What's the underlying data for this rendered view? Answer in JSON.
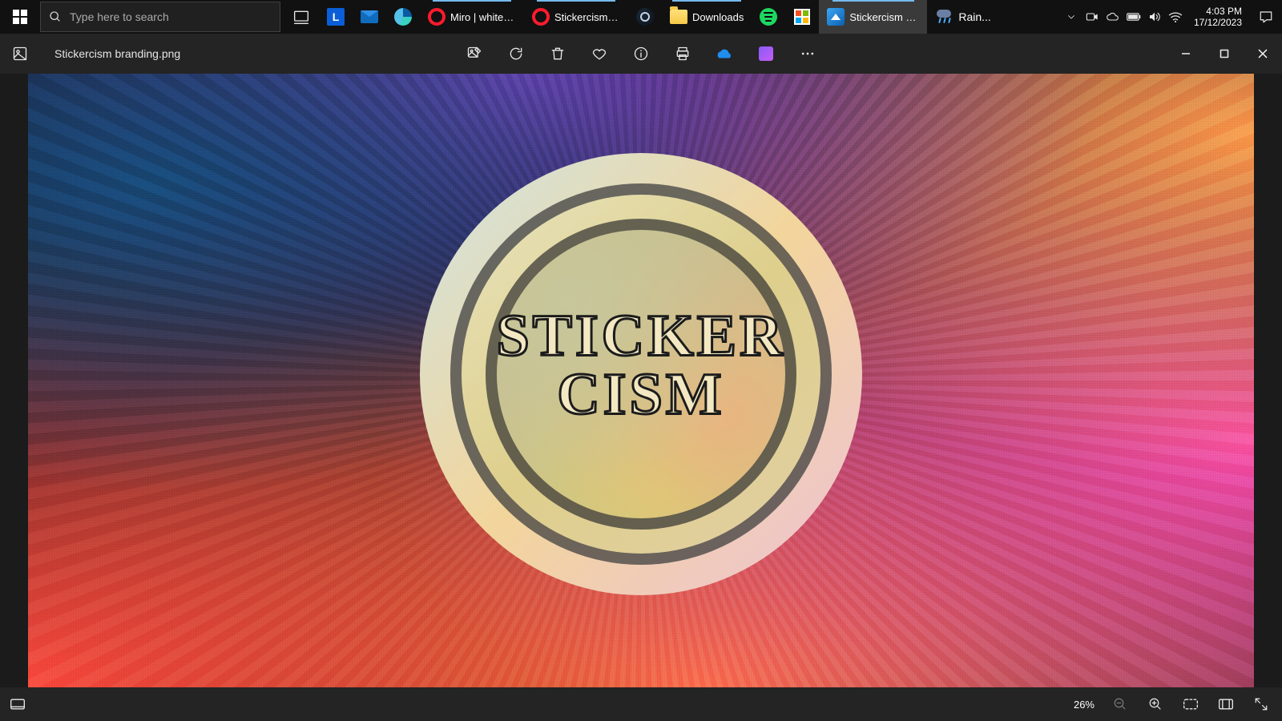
{
  "taskbar": {
    "search_placeholder": "Type here to search",
    "items": [
      {
        "label": "Miro | whiteb..."
      },
      {
        "label": "Stickercism b..."
      },
      {
        "label": "Downloads"
      },
      {
        "label": "Stickercism b..."
      }
    ],
    "weather_label": "Rain...",
    "clock_time": "4:03 PM",
    "clock_date": "17/12/2023"
  },
  "app": {
    "filename": "Stickercism branding.png",
    "logo_line1": "STICKER",
    "logo_line2": "CISM",
    "zoom_pct": "26%"
  },
  "L_tile_letter": "L"
}
